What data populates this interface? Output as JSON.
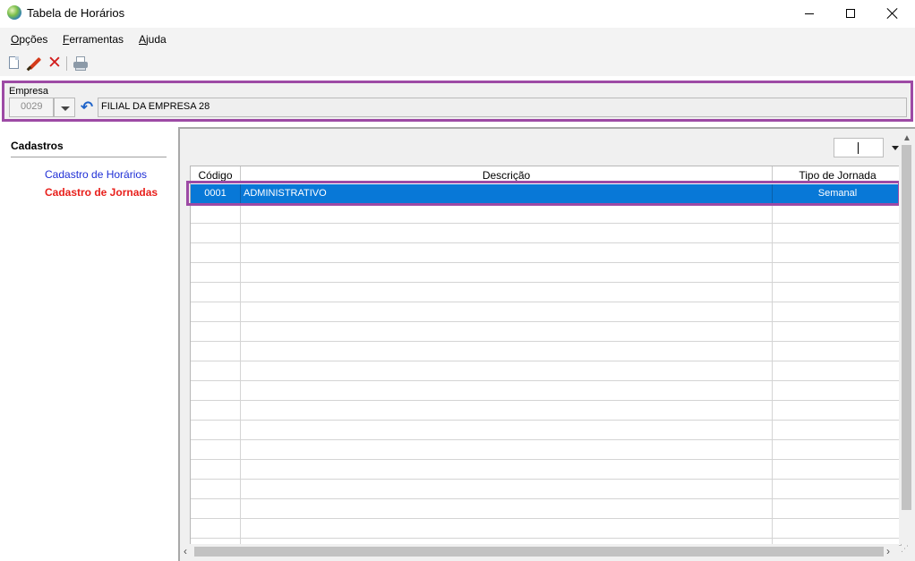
{
  "window": {
    "title": "Tabela de Horários"
  },
  "menu": {
    "items": [
      {
        "mnemonic": "O",
        "rest": "pções"
      },
      {
        "mnemonic": "F",
        "rest": "erramentas"
      },
      {
        "mnemonic": "A",
        "rest": "juda"
      }
    ]
  },
  "toolbar": {
    "icons": [
      "new-document-icon",
      "edit-icon",
      "delete-icon",
      "print-icon"
    ]
  },
  "empresa": {
    "label": "Empresa",
    "code": "0029",
    "name": "FILIAL DA EMPRESA 28"
  },
  "sidebar": {
    "title": "Cadastros",
    "links": [
      {
        "label": "Cadastro de Horários",
        "color": "#1f2fd6"
      },
      {
        "label": "Cadastro de Jornadas",
        "color": "#e8201c"
      }
    ]
  },
  "grid": {
    "columns": [
      "Código",
      "Descrição",
      "Tipo de Jornada"
    ],
    "rows": [
      {
        "codigo": "0001",
        "descricao": "ADMINISTRATIVO",
        "tipo": "Semanal",
        "selected": true
      }
    ]
  },
  "colors": {
    "selection": "#0878d7",
    "highlight_outline": "#9d4aa5"
  }
}
